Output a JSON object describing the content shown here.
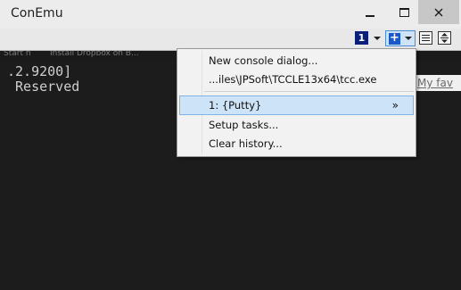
{
  "window": {
    "title": "ConEmu"
  },
  "toolbar": {
    "active_tab_number": "1",
    "new_console_glyph": "+"
  },
  "tabstrip": {
    "items": [
      "Start n",
      "Install Dropbox on B..."
    ]
  },
  "console": {
    "lines": [
      ".2.9200]",
      " Reserved"
    ],
    "right_fragment": "My fav"
  },
  "menu": {
    "items": [
      {
        "label": "New console dialog..."
      },
      {
        "label": "...iles\\JPSoft\\TCCLE13x64\\tcc.exe"
      },
      {
        "label": "1: {Putty}",
        "submenu": "»",
        "selected": true
      },
      {
        "label": "Setup tasks..."
      },
      {
        "label": "Clear history..."
      }
    ]
  },
  "colors": {
    "titlebar_bg": "#ececec",
    "console_bg": "#1c1c1c",
    "tab_number_bg": "#0b1f7a",
    "plus_button_bg": "#1a58c9",
    "menu_highlight": "#cde3f7"
  },
  "icons": {
    "minimize": "minimize-icon",
    "maximize": "maximize-icon",
    "close": "close-icon",
    "new_console": "plus-icon",
    "dropdown": "chevron-down-icon",
    "menu": "hamburger-icon",
    "scroll": "scroll-icon"
  }
}
